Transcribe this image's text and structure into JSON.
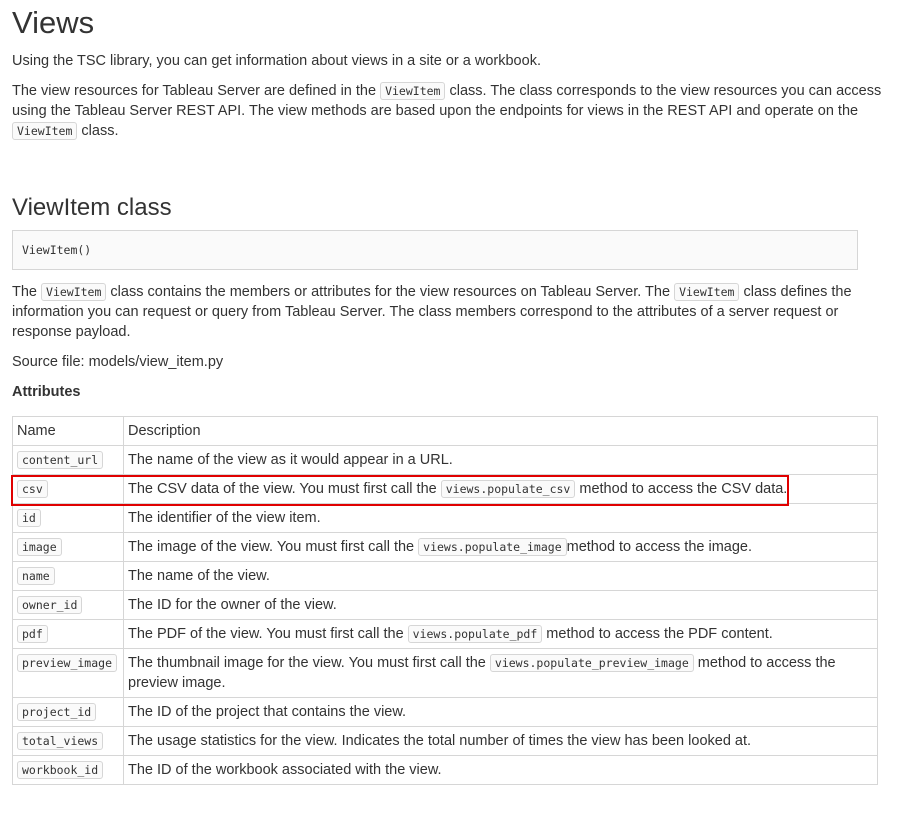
{
  "page": {
    "title": "Views",
    "intro": "Using the TSC library, you can get information about views in a site or a workbook.",
    "para2": {
      "t1": "The view resources for Tableau Server are defined in the ",
      "c1": "ViewItem",
      "t2": " class. The class corresponds to the view resources you can access using the Tableau Server REST API. The view methods are based upon the endpoints for views in the REST API and operate on the ",
      "c2": "ViewItem",
      "t3": " class."
    }
  },
  "section": {
    "heading": "ViewItem class",
    "signature": "ViewItem()",
    "desc": {
      "t1": "The ",
      "c1": "ViewItem",
      "t2": " class contains the members or attributes for the view resources on Tableau Server. The ",
      "c2": "ViewItem",
      "t3": " class defines the information you can request or query from Tableau Server. The class members correspond to the attributes of a server request or response payload."
    },
    "source": "Source file: models/view_item.py",
    "attributes_heading": "Attributes"
  },
  "table": {
    "headers": [
      "Name",
      "Description"
    ],
    "rows": [
      {
        "name": "content_url",
        "d1": "The name of the view as it would appear in a URL.",
        "code": "",
        "d2": ""
      },
      {
        "name": "csv",
        "d1": "The CSV data of the view. You must first call the ",
        "code": "views.populate_csv",
        "d2": " method to access the CSV data."
      },
      {
        "name": "id",
        "d1": "The identifier of the view item.",
        "code": "",
        "d2": ""
      },
      {
        "name": "image",
        "d1": "The image of the view. You must first call the ",
        "code": "views.populate_image",
        "d2": "method to access the image."
      },
      {
        "name": "name",
        "d1": "The name of the view.",
        "code": "",
        "d2": ""
      },
      {
        "name": "owner_id",
        "d1": "The ID for the owner of the view.",
        "code": "",
        "d2": ""
      },
      {
        "name": "pdf",
        "d1": "The PDF of the view. You must first call the ",
        "code": "views.populate_pdf",
        "d2": " method to access the PDF content."
      },
      {
        "name": "preview_image",
        "d1": "The thumbnail image for the view. You must first call the ",
        "code": "views.populate_preview_image",
        "d2": " method to access the preview image."
      },
      {
        "name": "project_id",
        "d1": "The ID of the project that contains the view.",
        "code": "",
        "d2": ""
      },
      {
        "name": "total_views",
        "d1": "The usage statistics for the view. Indicates the total number of times the view has been looked at.",
        "code": "",
        "d2": ""
      },
      {
        "name": "workbook_id",
        "d1": "The ID of the workbook associated with the view.",
        "code": "",
        "d2": ""
      }
    ]
  },
  "colors": {
    "highlight_border": "#e00000"
  }
}
